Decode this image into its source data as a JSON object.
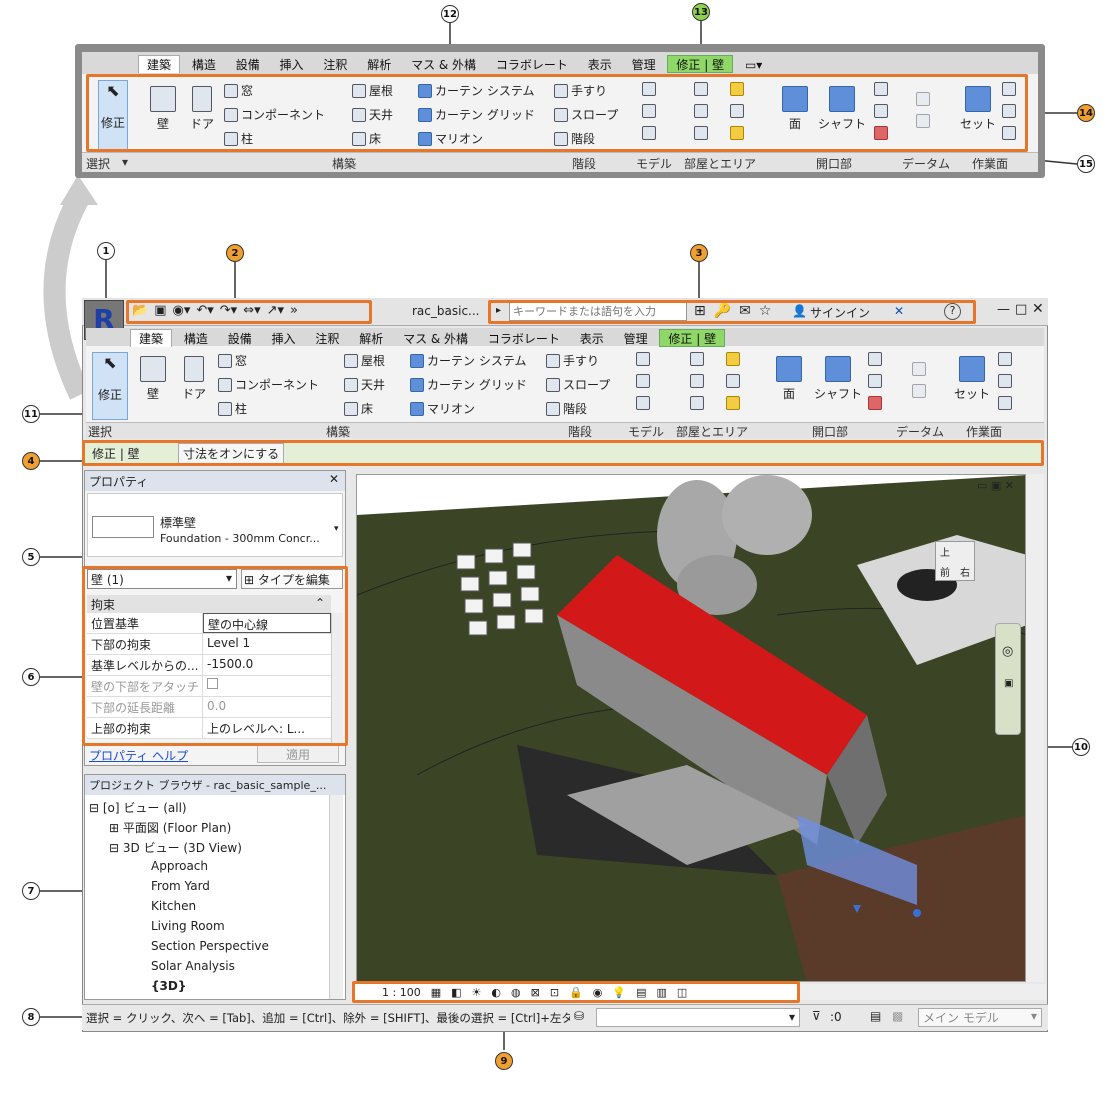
{
  "callouts": [
    "1",
    "2",
    "3",
    "4",
    "5",
    "6",
    "7",
    "8",
    "9",
    "10",
    "11",
    "12",
    "13",
    "14",
    "15"
  ],
  "ribbon": {
    "tabs": [
      "建築",
      "構造",
      "設備",
      "挿入",
      "注釈",
      "解析",
      "マス & 外構",
      "コラボレート",
      "表示",
      "管理"
    ],
    "context_tab": "修正 | 壁",
    "modify": "修正",
    "wall": "壁",
    "door": "ドア",
    "window": "窓",
    "component": "コンポーネント",
    "column": "柱",
    "roof": "屋根",
    "ceiling": "天井",
    "floor": "床",
    "curtain_system": "カーテン システム",
    "curtain_grid": "カーテン グリッド",
    "mullion": "マリオン",
    "railing": "手すり",
    "ramp": "スロープ",
    "stair": "階段",
    "face": "面",
    "shaft": "シャフト",
    "set": "セット",
    "panels": {
      "select": "選択",
      "build": "構築",
      "circulation": "階段",
      "model": "モデル",
      "room": "部屋とエリア",
      "opening": "開口部",
      "datum": "データム",
      "workplane": "作業面"
    }
  },
  "titlebar": {
    "file": "rac_basic...",
    "search_placeholder": "キーワードまたは語句を入力",
    "signin": "サインイン",
    "help": "?"
  },
  "options_bar": {
    "context": "修正 | 壁",
    "toggle": "寸法をオンにする"
  },
  "properties": {
    "title": "プロパティ",
    "type_family": "標準壁",
    "type_name": "Foundation - 300mm Concr...",
    "filter": "壁 (1)",
    "edit_type": "タイプを編集",
    "group": "拘束",
    "rows": [
      {
        "k": "位置基準",
        "v": "壁の中心線"
      },
      {
        "k": "下部の拘束",
        "v": "Level 1"
      },
      {
        "k": "基準レベルからの...",
        "v": "-1500.0"
      },
      {
        "k": "壁の下部をアタッチ",
        "v": ""
      },
      {
        "k": "下部の延長距離",
        "v": "0.0"
      },
      {
        "k": "上部の拘束",
        "v": "上のレベルへ: L..."
      }
    ],
    "help": "プロパティ ヘルプ",
    "apply": "適用"
  },
  "browser": {
    "title": "プロジェクト ブラウザ - rac_basic_sample_...",
    "items": [
      "ビュー (all)",
      "平面図 (Floor Plan)",
      "3D ビュー (3D View)",
      "Approach",
      "From Yard",
      "Kitchen",
      "Living Room",
      "Section Perspective",
      "Solar Analysis",
      "{3D}"
    ]
  },
  "view": {
    "scale": "1 : 100",
    "viewcube_top": "上",
    "viewcube_front": "前",
    "viewcube_right": "右"
  },
  "status": {
    "text": "選択 = クリック、次へ = [Tab]、追加 = [Ctrl]、除外 = [SHIFT]、最後の選択 = [Ctrl]+左タ",
    "count": ":0",
    "model": "メイン モデル"
  },
  "colors": {
    "accent": "#e8762a",
    "ctx_tab": "#8fd868",
    "roof": "#d21818",
    "terrain": "#3b4525"
  }
}
